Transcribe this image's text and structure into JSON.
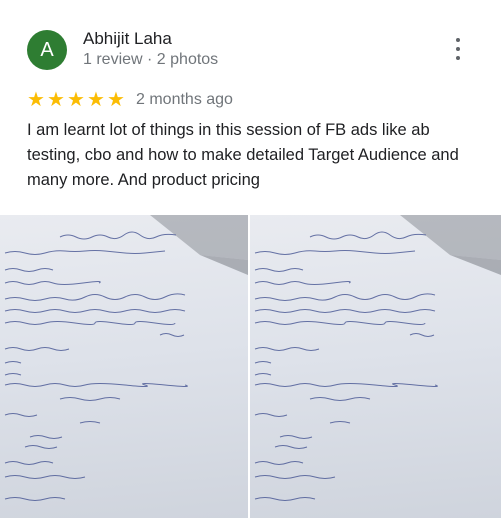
{
  "reviewer": {
    "avatar_letter": "A",
    "avatar_color": "#2e7d32",
    "name": "Abhijit Laha",
    "meta": "1 review · 2 photos"
  },
  "rating": {
    "stars": 5,
    "star_color": "#fbbc04",
    "date": "2 months ago"
  },
  "review_text": "I am learnt lot of things in this session of FB ads like ab testing, cbo and how to make detailed Target Audience and many more. And product pricing",
  "photos": [
    {
      "description_icon": "handwritten-notes-photo"
    },
    {
      "description_icon": "handwritten-notes-photo"
    }
  ],
  "icons": {
    "more": "more-vert-icon",
    "star": "star-icon"
  }
}
